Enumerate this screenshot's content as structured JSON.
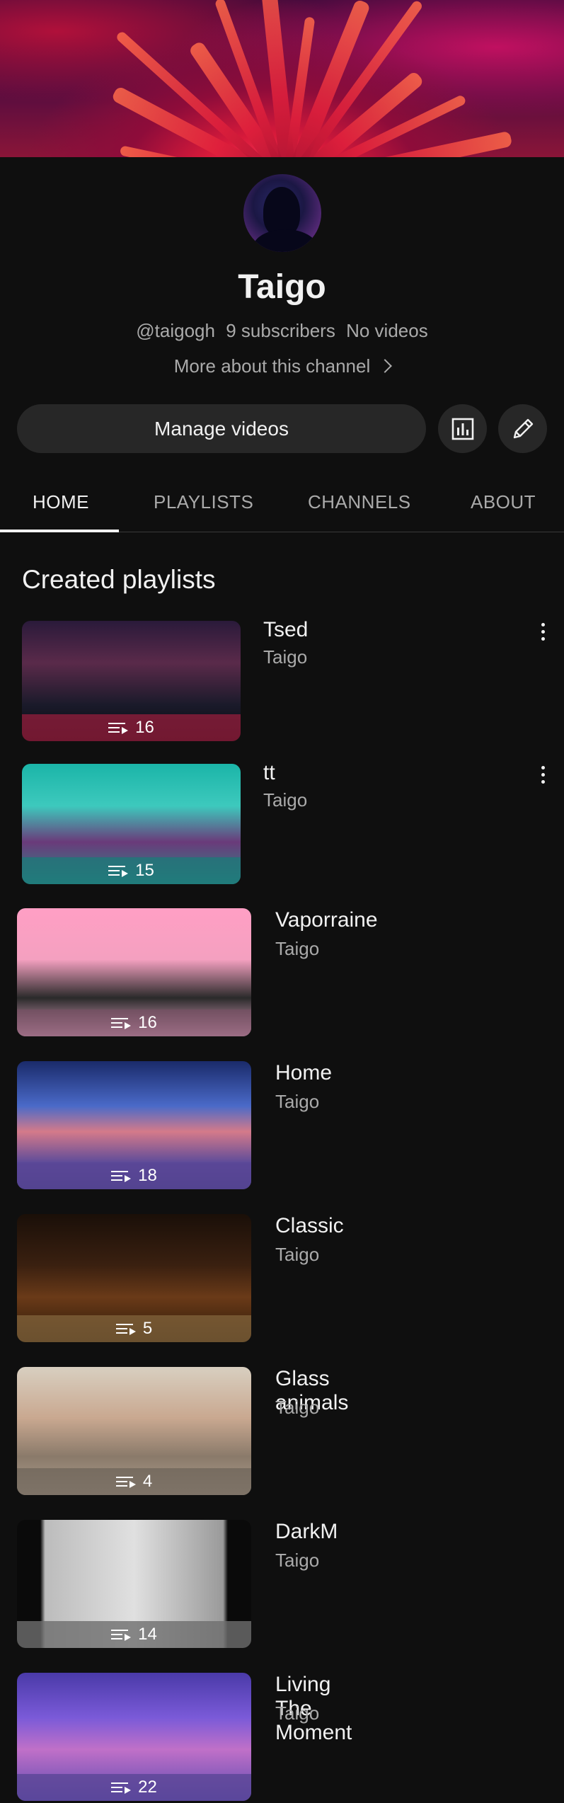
{
  "channel": {
    "name": "Taigo",
    "handle": "@taigogh",
    "subscribers": "9 subscribers",
    "videos": "No videos",
    "more_about": "More about this channel"
  },
  "actions": {
    "manage_videos": "Manage videos"
  },
  "tabs": [
    {
      "label": "HOME",
      "active": true
    },
    {
      "label": "PLAYLISTS",
      "active": false
    },
    {
      "label": "CHANNELS",
      "active": false
    },
    {
      "label": "ABOUT",
      "active": false
    }
  ],
  "section": {
    "title": "Created playlists"
  },
  "playlists": [
    {
      "title": "Tsed",
      "owner": "Taigo",
      "count": "16",
      "has_menu": true
    },
    {
      "title": "tt",
      "owner": "Taigo",
      "count": "15",
      "has_menu": true
    },
    {
      "title": "Vaporraine",
      "owner": "Taigo",
      "count": "16",
      "has_menu": false
    },
    {
      "title": "Home",
      "owner": "Taigo",
      "count": "18",
      "has_menu": false
    },
    {
      "title": "Classic",
      "owner": "Taigo",
      "count": "5",
      "has_menu": false
    },
    {
      "title": "Glass animals",
      "owner": "Taigo",
      "count": "4",
      "has_menu": false
    },
    {
      "title": "DarkM",
      "owner": "Taigo",
      "count": "14",
      "has_menu": false
    },
    {
      "title": "Living The Moment",
      "owner": "Taigo",
      "count": "22",
      "has_menu": false
    }
  ],
  "icons": {
    "analytics": "bar-chart-icon",
    "edit": "pencil-icon",
    "more": "more-vert-icon",
    "playlist": "playlist-play-icon"
  }
}
